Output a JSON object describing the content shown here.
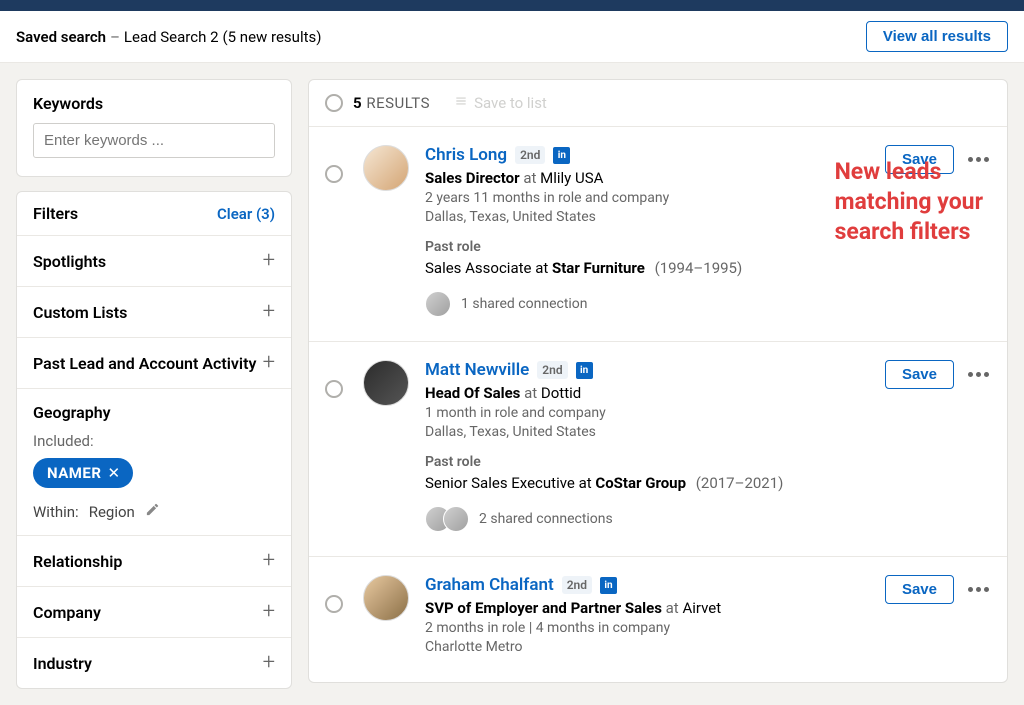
{
  "header": {
    "saved_search_label": "Saved search",
    "dash": " – ",
    "search_name": "Lead Search 2",
    "new_results": "(5 new results)",
    "view_all": "View all results"
  },
  "keywords": {
    "title": "Keywords",
    "placeholder": "Enter keywords ..."
  },
  "filters": {
    "title": "Filters",
    "clear": "Clear (3)",
    "spotlights": "Spotlights",
    "custom_lists": "Custom Lists",
    "past_activity": "Past Lead and Account Activity",
    "geography": "Geography",
    "included": "Included:",
    "pill": "NAMER",
    "within_label": "Within:",
    "within_value": "Region",
    "relationship": "Relationship",
    "company": "Company",
    "industry": "Industry"
  },
  "results": {
    "count": "5",
    "label": "RESULTS",
    "save_to_list": "Save to list",
    "save": "Save",
    "overlay": "New leads matching your search filters",
    "leads": [
      {
        "name": "Chris Long",
        "degree": "2nd",
        "title": "Sales Director",
        "company": "Mlily USA",
        "tenure": "2 years 11 months in role and company",
        "location": "Dallas, Texas, United States",
        "past_label": "Past role",
        "past_title": "Sales Associate at ",
        "past_company": "Star Furniture",
        "past_years": "(1994–1995)",
        "connections": "1 shared connection",
        "conn_count": 1
      },
      {
        "name": "Matt Newville",
        "degree": "2nd",
        "title": "Head Of Sales",
        "company": "Dottid",
        "tenure": "1 month in role and company",
        "location": "Dallas, Texas, United States",
        "past_label": "Past role",
        "past_title": "Senior Sales Executive at ",
        "past_company": "CoStar Group",
        "past_years": "(2017–2021)",
        "connections": "2 shared connections",
        "conn_count": 2
      },
      {
        "name": "Graham Chalfant",
        "degree": "2nd",
        "title": "SVP of Employer and Partner Sales",
        "company": "Airvet",
        "tenure": "2 months in role  | 4 months in company",
        "location": "Charlotte Metro",
        "past_label": "",
        "past_title": "",
        "past_company": "",
        "past_years": "",
        "connections": "",
        "conn_count": 0
      }
    ]
  }
}
